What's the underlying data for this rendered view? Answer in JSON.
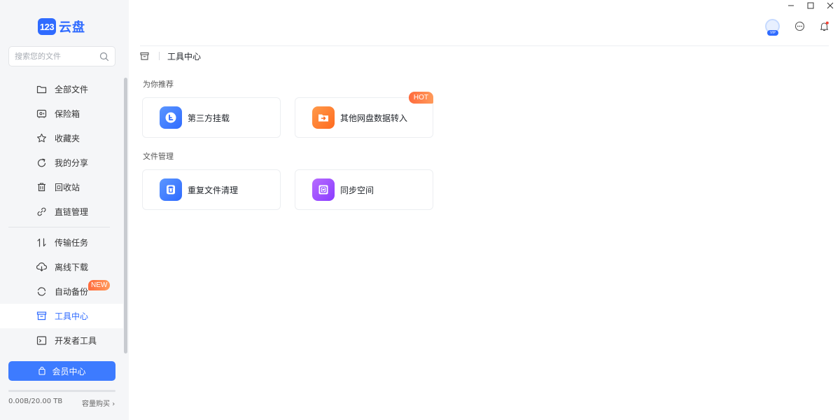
{
  "app": {
    "logo_number": "123",
    "logo_text": "云盘"
  },
  "search": {
    "placeholder": "搜索您的文件"
  },
  "sidebar": {
    "items": [
      {
        "label": "全部文件"
      },
      {
        "label": "保险箱"
      },
      {
        "label": "收藏夹"
      },
      {
        "label": "我的分享"
      },
      {
        "label": "回收站"
      },
      {
        "label": "直链管理"
      },
      {
        "label": "传输任务"
      },
      {
        "label": "离线下载"
      },
      {
        "label": "自动备份",
        "badge": "NEW"
      },
      {
        "label": "工具中心",
        "active": true
      },
      {
        "label": "开发者工具"
      }
    ],
    "vip_button": "会员中心",
    "storage_text": "0.00B/20.00 TB",
    "storage_used_fraction": 0.0,
    "buy_link": "容量购买"
  },
  "header": {
    "vip_tag": "VIP"
  },
  "breadcrumb": {
    "current": "工具中心"
  },
  "sections": [
    {
      "title": "为你推荐",
      "cards": [
        {
          "label": "第三方挂载",
          "color": "#3d7bff"
        },
        {
          "label": "其他网盘数据转入",
          "color": "#ff7a2e",
          "badge": "HOT"
        }
      ]
    },
    {
      "title": "文件管理",
      "cards": [
        {
          "label": "重复文件清理",
          "color": "#3d7bff"
        },
        {
          "label": "同步空间",
          "color": "#9747ff"
        }
      ]
    }
  ],
  "colors": {
    "accent": "#2f6bff",
    "hot": "#ff6b3d"
  }
}
